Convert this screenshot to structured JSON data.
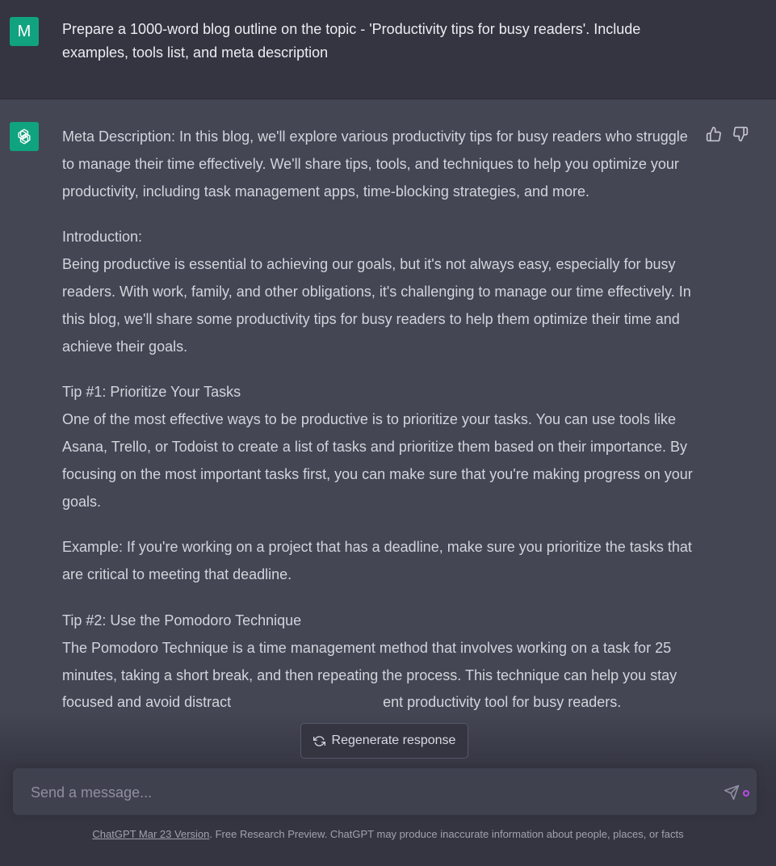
{
  "user_message": {
    "avatar_letter": "M",
    "text": "Prepare a 1000-word blog outline on the topic - 'Productivity tips for busy readers'. Include examples, tools list, and meta description"
  },
  "assistant_message": {
    "paragraphs": [
      {
        "lines": [
          "Meta Description: In this blog, we'll explore various productivity tips for busy readers who struggle to manage their time effectively. We'll share tips, tools, and techniques to help you optimize your productivity, including task management apps, time-blocking strategies, and more."
        ]
      },
      {
        "lines": [
          "Introduction:",
          "Being productive is essential to achieving our goals, but it's not always easy, especially for busy readers. With work, family, and other obligations, it's challenging to manage our time effectively. In this blog, we'll share some productivity tips for busy readers to help them optimize their time and achieve their goals."
        ]
      },
      {
        "lines": [
          "Tip #1: Prioritize Your Tasks",
          "One of the most effective ways to be productive is to prioritize your tasks. You can use tools like Asana, Trello, or Todoist to create a list of tasks and prioritize them based on their importance. By focusing on the most important tasks first, you can make sure that you're making progress on your goals."
        ]
      },
      {
        "lines": [
          "Example: If you're working on a project that has a deadline, make sure you prioritize the tasks that are critical to meeting that deadline."
        ]
      },
      {
        "lines": [
          "Tip #2: Use the Pomodoro Technique",
          "The Pomodoro Technique is a time management method that involves working on a task for 25 minutes, taking a short break, and then repeating the process. This technique can help you stay focused and avoid distract",
          "ent productivity tool for busy readers."
        ]
      }
    ],
    "icons": {
      "avatar": "openai-logo-icon",
      "like": "thumbs-up-icon",
      "dislike": "thumbs-down-icon"
    }
  },
  "regenerate": {
    "label": "Regenerate response",
    "icon": "refresh-icon"
  },
  "composer": {
    "placeholder": "Send a message...",
    "send_icon": "send-icon"
  },
  "footer": {
    "link_text": "ChatGPT Mar 23 Version",
    "text": ". Free Research Preview. ChatGPT may produce inaccurate information about people, places, or facts"
  },
  "colors": {
    "accent": "#10a37f",
    "user_bg": "#343541",
    "assistant_bg": "#444654",
    "status_dot": "#b84ce3"
  }
}
